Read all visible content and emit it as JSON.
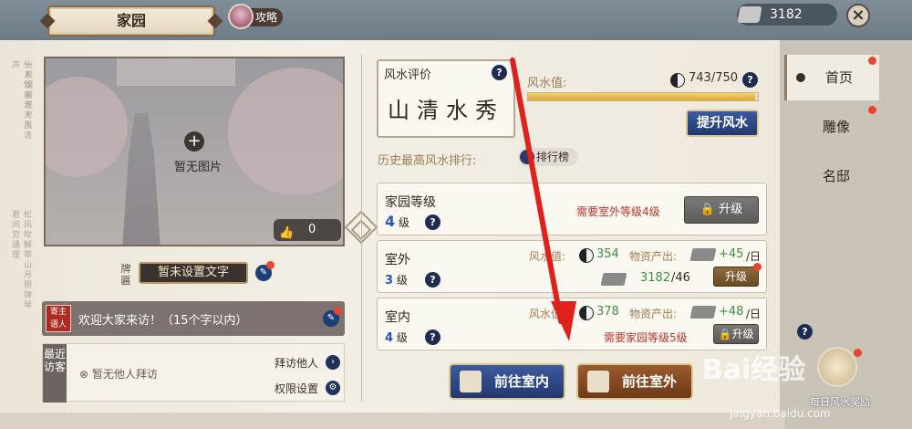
{
  "header": {
    "title": "家园",
    "guide_label": "攻略",
    "currency_value": "3182",
    "close_icon": "close-icon"
  },
  "left": {
    "photo_empty": "暂无图片",
    "likes": "0",
    "plaque_label": "牌匾",
    "plaque_text": "暂未设置文字",
    "welcome_seal": "寄主\n语人",
    "welcome_text": "欢迎大家来访！（15个字以内）",
    "visitors_tag": "最近访客",
    "visitors_empty": "暂无他人拜访",
    "visit_others": "拜访他人",
    "permission": "权限设置"
  },
  "fengshui": {
    "eval_title": "风水评价",
    "eval_text": "山清水秀",
    "value_label": "风水值:",
    "value": "743/750",
    "progress": 0.99,
    "upgrade_btn": "提升风水",
    "history_label": "历史最高风水排行:",
    "rank_btn": "排行榜"
  },
  "home_level": {
    "name": "家园等级",
    "level": "4",
    "unit": "级",
    "req": "需要室外等级4级",
    "btn": "升级"
  },
  "outdoor": {
    "name": "室外",
    "level": "3",
    "unit": "级",
    "fs_label": "风水值:",
    "fs_value": "354",
    "prod_label": "物资产出:",
    "prod_value": "+45",
    "prod_unit": "/日",
    "cost": "3182",
    "cost_need": "/46",
    "btn": "升级"
  },
  "indoor": {
    "name": "室内",
    "level": "4",
    "unit": "级",
    "fs_label": "风水值:",
    "fs_value": "378",
    "prod_label": "物资产出:",
    "prod_value": "+48",
    "prod_unit": "/日",
    "req": "需要家园等级5级",
    "btn": "升级"
  },
  "actions": {
    "go_indoor": "前往室内",
    "go_outdoor": "前往室外"
  },
  "sidebar": {
    "items": [
      {
        "label": "首页"
      },
      {
        "label": "雕像"
      },
      {
        "label": "名邸"
      }
    ],
    "reward": "每日风水奖励"
  },
  "watermark": {
    "main": "Bai经验",
    "sub": "jingyan.baidu.com"
  },
  "colors": {
    "accent_blue": "#23386e",
    "red_text": "#b8342a",
    "green_text": "#3d8f47",
    "annotation_arrow": "#e0201a"
  }
}
